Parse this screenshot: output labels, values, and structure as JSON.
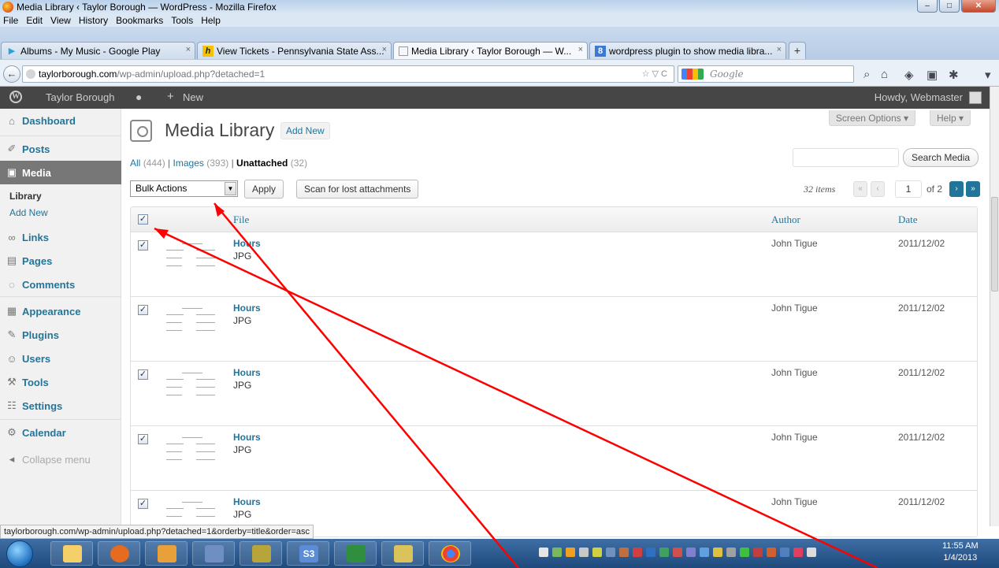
{
  "window": {
    "title": "Media Library ‹ Taylor Borough — WordPress - Mozilla Firefox"
  },
  "menubar": [
    "File",
    "Edit",
    "View",
    "History",
    "Bookmarks",
    "Tools",
    "Help"
  ],
  "tabs": [
    {
      "label": "Albums - My Music - Google Play"
    },
    {
      "label": "View Tickets - Pennsylvania State Ass..."
    },
    {
      "label": "Media Library ‹ Taylor Borough — W..."
    },
    {
      "label": "wordpress plugin to show media libra..."
    }
  ],
  "nav": {
    "url_domain": "taylorborough.com",
    "url_path": "/wp-admin/upload.php?detached=1",
    "search_placeholder": "Google"
  },
  "adminbar": {
    "site": "Taylor Borough",
    "new": "New",
    "howdy": "Howdy, Webmaster"
  },
  "sidebar": {
    "dashboard": "Dashboard",
    "posts": "Posts",
    "media": "Media",
    "library": "Library",
    "add_new": "Add New",
    "links": "Links",
    "pages": "Pages",
    "comments": "Comments",
    "appearance": "Appearance",
    "plugins": "Plugins",
    "users": "Users",
    "tools": "Tools",
    "settings": "Settings",
    "calendar": "Calendar",
    "collapse": "Collapse menu"
  },
  "main": {
    "screen_options": "Screen Options ▾",
    "help": "Help ▾",
    "title": "Media Library",
    "add_new": "Add New",
    "filters": {
      "all": "All",
      "all_count": "(444)",
      "images": "Images",
      "images_count": "(393)",
      "unattached": "Unattached",
      "unattached_count": "(32)",
      "sep": "|"
    },
    "search_button": "Search Media",
    "bulk_actions": "Bulk Actions",
    "apply": "Apply",
    "scan": "Scan for lost attachments",
    "items": "32 items",
    "page_current": "1",
    "page_of": "of 2",
    "columns": {
      "file": "File",
      "author": "Author",
      "date": "Date"
    },
    "rows": [
      {
        "name": "Hours",
        "type": "JPG",
        "author": "John Tigue",
        "date": "2011/12/02"
      },
      {
        "name": "Hours",
        "type": "JPG",
        "author": "John Tigue",
        "date": "2011/12/02"
      },
      {
        "name": "Hours",
        "type": "JPG",
        "author": "John Tigue",
        "date": "2011/12/02"
      },
      {
        "name": "Hours",
        "type": "JPG",
        "author": "John Tigue",
        "date": "2011/12/02"
      },
      {
        "name": "Hours",
        "type": "JPG",
        "author": "John Tigue",
        "date": "2011/12/02"
      }
    ]
  },
  "statusbar": "taylorborough.com/wp-admin/upload.php?detached=1&orderby=title&order=asc",
  "clock": {
    "time": "11:55 AM",
    "date": "1/4/2013"
  },
  "colors": {
    "wp_link": "#21759b",
    "admin_bar": "#464646",
    "arrow": "#ff0000"
  }
}
